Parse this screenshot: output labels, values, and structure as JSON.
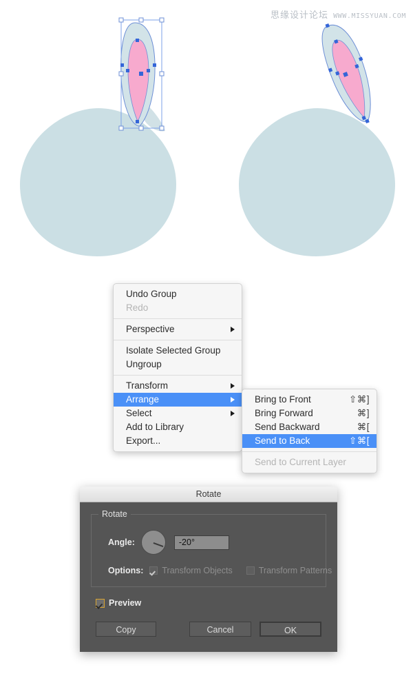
{
  "watermark": {
    "cn_text": "思缘设计论坛",
    "en_text": "WWW.MISSYUAN.COM"
  },
  "illustration": {
    "description": "Two bunny-head vector illustrations; left shows the ear selected with a bounding box, right shows the ear rotated -20 degrees and sent behind the head",
    "colors": {
      "head_fill": "#cbdfe4",
      "ear_outer_fill": "#d2e3e8",
      "ear_inner_fill": "#f7aace",
      "path_stroke": "#6d8fd6",
      "anchor_fill": "#3465d8",
      "handle_fill": "#ffffff",
      "bbox_stroke": "#7ba0e8"
    },
    "left_figure": {
      "label": "selected-ear-upright",
      "rotation_deg": 0
    },
    "right_figure": {
      "label": "rotated-ear-behind-head",
      "rotation_deg": -20
    }
  },
  "context_menu": {
    "name": "object-context-menu",
    "groups": [
      [
        {
          "label": "Undo Group",
          "disabled": false,
          "submenu": false,
          "selected": false
        },
        {
          "label": "Redo",
          "disabled": true,
          "submenu": false,
          "selected": false
        }
      ],
      [
        {
          "label": "Perspective",
          "disabled": false,
          "submenu": true,
          "selected": false
        }
      ],
      [
        {
          "label": "Isolate Selected Group",
          "disabled": false,
          "submenu": false,
          "selected": false
        },
        {
          "label": "Ungroup",
          "disabled": false,
          "submenu": false,
          "selected": false
        }
      ],
      [
        {
          "label": "Transform",
          "disabled": false,
          "submenu": true,
          "selected": false
        },
        {
          "label": "Arrange",
          "disabled": false,
          "submenu": true,
          "selected": true
        },
        {
          "label": "Select",
          "disabled": false,
          "submenu": true,
          "selected": false
        },
        {
          "label": "Add to Library",
          "disabled": false,
          "submenu": false,
          "selected": false
        },
        {
          "label": "Export...",
          "disabled": false,
          "submenu": false,
          "selected": false
        }
      ]
    ]
  },
  "arrange_submenu": {
    "name": "arrange-submenu",
    "groups": [
      [
        {
          "label": "Bring to Front",
          "shortcut": "⇧⌘]",
          "disabled": false,
          "selected": false
        },
        {
          "label": "Bring Forward",
          "shortcut": "⌘]",
          "disabled": false,
          "selected": false
        },
        {
          "label": "Send Backward",
          "shortcut": "⌘[",
          "disabled": false,
          "selected": false
        },
        {
          "label": "Send to Back",
          "shortcut": "⇧⌘[",
          "disabled": false,
          "selected": true
        }
      ],
      [
        {
          "label": "Send to Current Layer",
          "shortcut": "",
          "disabled": true,
          "selected": false
        }
      ]
    ]
  },
  "rotate_dialog": {
    "title": "Rotate",
    "groupbox_legend": "Rotate",
    "angle_label": "Angle:",
    "angle_value": "-20°",
    "angle_dial_rotation_deg": -20,
    "options_label": "Options:",
    "options": [
      {
        "label": "Transform Objects",
        "checked": true,
        "disabled": true
      },
      {
        "label": "Transform Patterns",
        "checked": false,
        "disabled": true
      }
    ],
    "preview_label": "Preview",
    "preview_checked": true,
    "buttons": {
      "copy": "Copy",
      "cancel": "Cancel",
      "ok": "OK"
    },
    "accent_color": "#d9a430"
  }
}
